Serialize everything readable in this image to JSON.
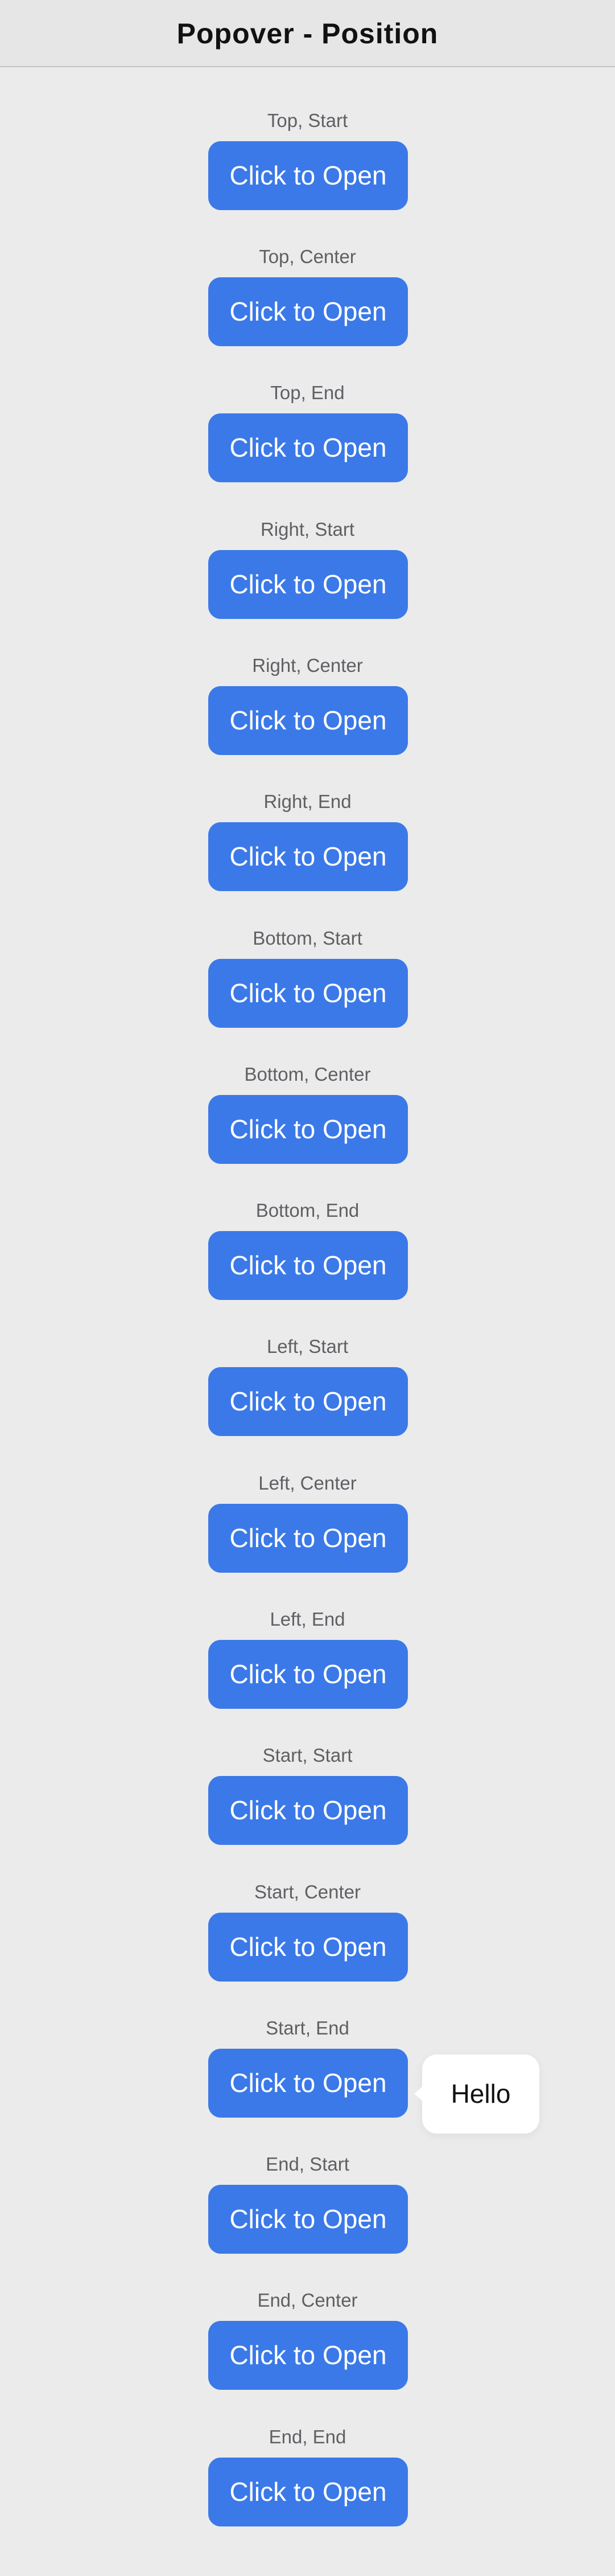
{
  "header": {
    "title": "Popover - Position"
  },
  "sections": [
    {
      "label": "Top, Start",
      "button_label": "Click to Open"
    },
    {
      "label": "Top, Center",
      "button_label": "Click to Open"
    },
    {
      "label": "Top, End",
      "button_label": "Click to Open"
    },
    {
      "label": "Right, Start",
      "button_label": "Click to Open"
    },
    {
      "label": "Right, Center",
      "button_label": "Click to Open"
    },
    {
      "label": "Right, End",
      "button_label": "Click to Open"
    },
    {
      "label": "Bottom, Start",
      "button_label": "Click to Open"
    },
    {
      "label": "Bottom, Center",
      "button_label": "Click to Open"
    },
    {
      "label": "Bottom, End",
      "button_label": "Click to Open"
    },
    {
      "label": "Left, Start",
      "button_label": "Click to Open"
    },
    {
      "label": "Left, Center",
      "button_label": "Click to Open"
    },
    {
      "label": "Left, End",
      "button_label": "Click to Open"
    },
    {
      "label": "Start, Start",
      "button_label": "Click to Open"
    },
    {
      "label": "Start, Center",
      "button_label": "Click to Open"
    },
    {
      "label": "Start, End",
      "button_label": "Click to Open"
    },
    {
      "label": "End, Start",
      "button_label": "Click to Open"
    },
    {
      "label": "End, Center",
      "button_label": "Click to Open"
    },
    {
      "label": "End, End",
      "button_label": "Click to Open"
    }
  ],
  "popover": {
    "text": "Hello"
  },
  "colors": {
    "accent": "#3b79e8",
    "background": "#ebebeb",
    "label_text": "#5f5f64"
  }
}
